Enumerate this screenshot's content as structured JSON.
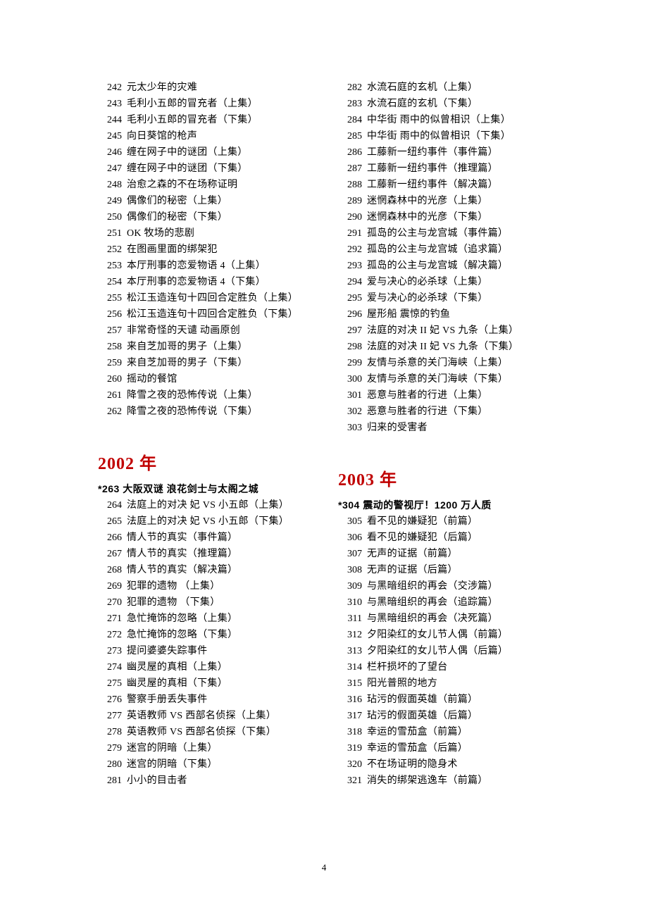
{
  "pageNumber": "4",
  "col1_block1": [
    {
      "n": "242",
      "t": "元太少年的灾难"
    },
    {
      "n": "243",
      "t": "毛利小五郎的冒充者（上集）"
    },
    {
      "n": "244",
      "t": "毛利小五郎的冒充者（下集）"
    },
    {
      "n": "245",
      "t": "向日葵馆的枪声"
    },
    {
      "n": "246",
      "t": "缠在网子中的谜团（上集）"
    },
    {
      "n": "247",
      "t": "缠在网子中的谜团（下集）"
    },
    {
      "n": "248",
      "t": "治愈之森的不在场称证明"
    },
    {
      "n": "249",
      "t": "偶像们的秘密（上集）"
    },
    {
      "n": "250",
      "t": "偶像们的秘密（下集）"
    },
    {
      "n": "251",
      "t": "OK 牧场的悲剧"
    },
    {
      "n": "252",
      "t": "在图画里面的绑架犯"
    },
    {
      "n": "253",
      "t": "本厅刑事的恋爱物语 4（上集）"
    },
    {
      "n": "254",
      "t": "本厅刑事的恋爱物语 4（下集）"
    },
    {
      "n": "255",
      "t": "松江玉造连句十四回合定胜负（上集）"
    },
    {
      "n": "256",
      "t": "松江玉造连句十四回合定胜负（下集）"
    },
    {
      "n": "257",
      "t": "非常奇怪的天谴 动画原创"
    },
    {
      "n": "258",
      "t": "来自芝加哥的男子（上集）"
    },
    {
      "n": "259",
      "t": "来自芝加哥的男子（下集）"
    },
    {
      "n": "260",
      "t": "摇动的餐馆"
    },
    {
      "n": "261",
      "t": "降雪之夜的恐怖传说（上集）"
    },
    {
      "n": "262",
      "t": "降雪之夜的恐怖传说（下集）"
    }
  ],
  "year2002": "2002 年",
  "movie2002": "*263 大阪双谜 浪花剑士与太阁之城",
  "col1_block2": [
    {
      "n": "264",
      "t": "法庭上的对决 妃 VS 小五郎（上集）"
    },
    {
      "n": "265",
      "t": "法庭上的对决 妃 VS 小五郎（下集）"
    },
    {
      "n": "266",
      "t": "情人节的真实（事件篇）"
    },
    {
      "n": "267",
      "t": "情人节的真实（推理篇）"
    },
    {
      "n": "268",
      "t": "情人节的真实（解决篇）"
    },
    {
      "n": "269",
      "t": "犯罪的遗物 （上集）"
    },
    {
      "n": "270",
      "t": "犯罪的遗物 （下集）"
    },
    {
      "n": "271",
      "t": "急忙掩饰的忽略（上集）"
    },
    {
      "n": "272",
      "t": "急忙掩饰的忽略（下集）"
    },
    {
      "n": "273",
      "t": "提问婆婆失踪事件"
    },
    {
      "n": "274",
      "t": "幽灵屋的真相（上集）"
    },
    {
      "n": "275",
      "t": "幽灵屋的真相（下集）"
    },
    {
      "n": "276",
      "t": "警察手册丢失事件"
    },
    {
      "n": "277",
      "t": "英语教师 VS 西部名侦探（上集）"
    },
    {
      "n": "278",
      "t": "英语教师 VS 西部名侦探（下集）"
    },
    {
      "n": "279",
      "t": "迷宫的阴暗（上集）"
    },
    {
      "n": "280",
      "t": "迷宫的阴暗（下集）"
    },
    {
      "n": "281",
      "t": "小小的目击者"
    }
  ],
  "col2_block1": [
    {
      "n": "282",
      "t": "水流石庭的玄机（上集）"
    },
    {
      "n": "283",
      "t": "水流石庭的玄机（下集）"
    },
    {
      "n": "284",
      "t": "中华街 雨中的似曾相识（上集）"
    },
    {
      "n": "285",
      "t": "中华街 雨中的似曾相识（下集）"
    },
    {
      "n": "286",
      "t": "工藤新一纽约事件（事件篇）"
    },
    {
      "n": "287",
      "t": "工藤新一纽约事件（推理篇）"
    },
    {
      "n": "288",
      "t": "工藤新一纽约事件（解决篇）"
    },
    {
      "n": "289",
      "t": "迷惘森林中的光彦（上集）"
    },
    {
      "n": "290",
      "t": "迷惘森林中的光彦（下集）"
    },
    {
      "n": "291",
      "t": "孤岛的公主与龙宫城（事件篇）"
    },
    {
      "n": "292",
      "t": "孤岛的公主与龙宫城（追求篇）"
    },
    {
      "n": "293",
      "t": "孤岛的公主与龙宫城（解决篇）"
    },
    {
      "n": "294",
      "t": "爱与决心的必杀球（上集）"
    },
    {
      "n": "295",
      "t": "爱与决心的必杀球（下集）"
    },
    {
      "n": "296",
      "t": "屋形船 震惊的钓鱼"
    },
    {
      "n": "297",
      "t": "法庭的对决 II 妃 VS 九条（上集）"
    },
    {
      "n": "298",
      "t": "法庭的对决 II 妃 VS 九条（下集）"
    },
    {
      "n": "299",
      "t": "友情与杀意的关门海峡（上集）"
    },
    {
      "n": "300",
      "t": "友情与杀意的关门海峡（下集）"
    },
    {
      "n": "301",
      "t": "恶意与胜者的行进（上集）"
    },
    {
      "n": "302",
      "t": "恶意与胜者的行进（下集）"
    },
    {
      "n": "303",
      "t": "归来的受害者"
    }
  ],
  "year2003": "2003 年",
  "movie2003": "*304 震动的警视厅！1200 万人质",
  "col2_block2": [
    {
      "n": "305",
      "t": "看不见的嫌疑犯（前篇）"
    },
    {
      "n": "306",
      "t": "看不见的嫌疑犯（后篇）"
    },
    {
      "n": "307",
      "t": "无声的证据（前篇）"
    },
    {
      "n": "308",
      "t": "无声的证据（后篇）"
    },
    {
      "n": "309",
      "t": "与黑暗组织的再会（交涉篇）"
    },
    {
      "n": "310",
      "t": "与黑暗组织的再会（追踪篇）"
    },
    {
      "n": "311",
      "t": "与黑暗组织的再会（决死篇）"
    },
    {
      "n": "312",
      "t": "夕阳染红的女儿节人偶（前篇）"
    },
    {
      "n": "313",
      "t": "夕阳染红的女儿节人偶（后篇）"
    },
    {
      "n": "314",
      "t": "栏杆损坏的了望台"
    },
    {
      "n": "315",
      "t": "阳光普照的地方"
    },
    {
      "n": "316",
      "t": "玷污的假面英雄（前篇）"
    },
    {
      "n": "317",
      "t": "玷污的假面英雄（后篇）"
    },
    {
      "n": "318",
      "t": "幸运的雪茄盒（前篇）"
    },
    {
      "n": "319",
      "t": "幸运的雪茄盒（后篇）"
    },
    {
      "n": "320",
      "t": "不在场证明的隐身术"
    },
    {
      "n": "321",
      "t": "消失的绑架逃逸车（前篇）"
    }
  ]
}
